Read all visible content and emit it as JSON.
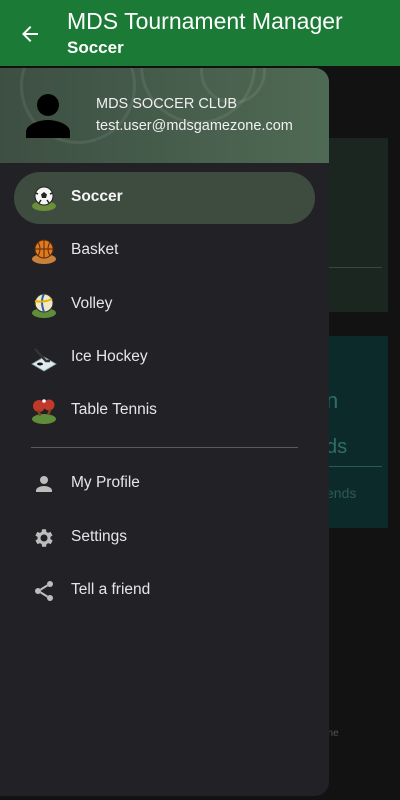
{
  "appbar": {
    "title": "MDS Tournament Manager",
    "subtitle": "Soccer"
  },
  "background": {
    "card2_line1": "n",
    "card2_line2": "ds",
    "card2_line3": "ends",
    "footer": "one"
  },
  "drawer": {
    "club_name": "MDS SOCCER CLUB",
    "email": "test.user@mdsgamezone.com",
    "sports": [
      {
        "label": "Soccer",
        "icon": "soccer-ball-icon",
        "active": true
      },
      {
        "label": "Basket",
        "icon": "basketball-icon",
        "active": false
      },
      {
        "label": "Volley",
        "icon": "volleyball-icon",
        "active": false
      },
      {
        "label": "Ice Hockey",
        "icon": "ice-hockey-icon",
        "active": false
      },
      {
        "label": "Table Tennis",
        "icon": "table-tennis-icon",
        "active": false
      }
    ],
    "menu": [
      {
        "label": "My Profile",
        "icon": "person-icon"
      },
      {
        "label": "Settings",
        "icon": "gear-icon"
      },
      {
        "label": "Tell a friend",
        "icon": "share-icon"
      }
    ]
  },
  "colors": {
    "appbar": "#1b7a35",
    "drawer": "#222126",
    "active_item": "#3e4c40"
  }
}
